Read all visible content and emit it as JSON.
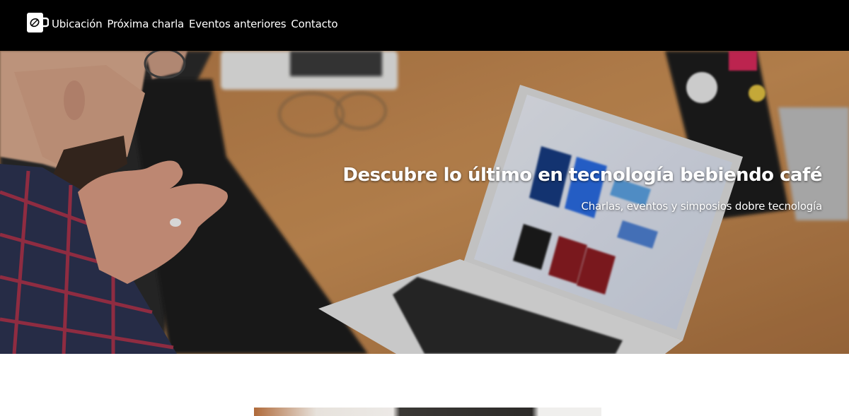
{
  "nav": {
    "logo_icon": "coffee-cup-icon",
    "links": [
      "Ubicación",
      "Próxima charla",
      "Eventos anteriores",
      "Contacto"
    ]
  },
  "hero": {
    "title": "Descubre lo último en tecnología bebiendo café",
    "subtitle": "Charlas, eventos y simposios dobre tecnología"
  },
  "colors": {
    "navbar_bg": "#000000",
    "nav_text": "#ffffff",
    "page_bg": "#ffffff"
  }
}
